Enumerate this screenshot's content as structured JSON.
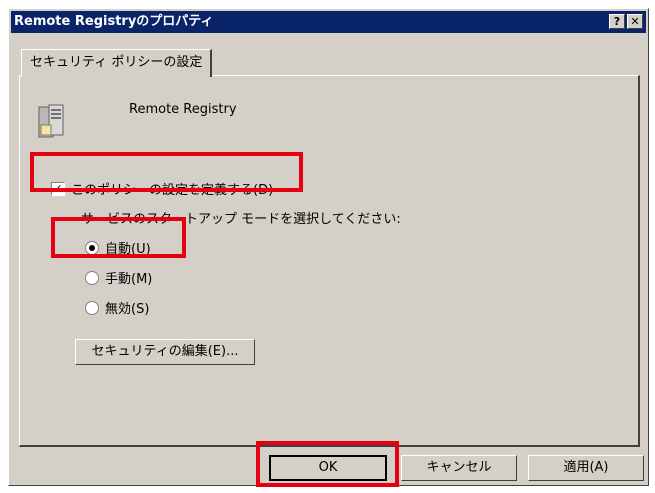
{
  "window": {
    "title": "Remote Registryのプロパティ",
    "help_label": "?",
    "close_label": "✕"
  },
  "tab": {
    "label": "セキュリティ ポリシーの設定"
  },
  "service": {
    "name": "Remote Registry",
    "icon": "server-icon"
  },
  "policy": {
    "define_label": "このポリシーの設定を定義する(D)",
    "define_checked": true,
    "instruction": "サービスのスタートアップ モードを選択してください:"
  },
  "startup": {
    "options": [
      {
        "label": "自動(U)",
        "selected": true
      },
      {
        "label": "手動(M)",
        "selected": false
      },
      {
        "label": "無効(S)",
        "selected": false
      }
    ]
  },
  "buttons": {
    "edit_security": "セキュリティの編集(E)...",
    "ok": "OK",
    "cancel": "キャンセル",
    "apply": "適用(A)"
  },
  "colors": {
    "highlight": "#e60012",
    "titlebar": "#0a246a",
    "face": "#d4d0c8"
  }
}
